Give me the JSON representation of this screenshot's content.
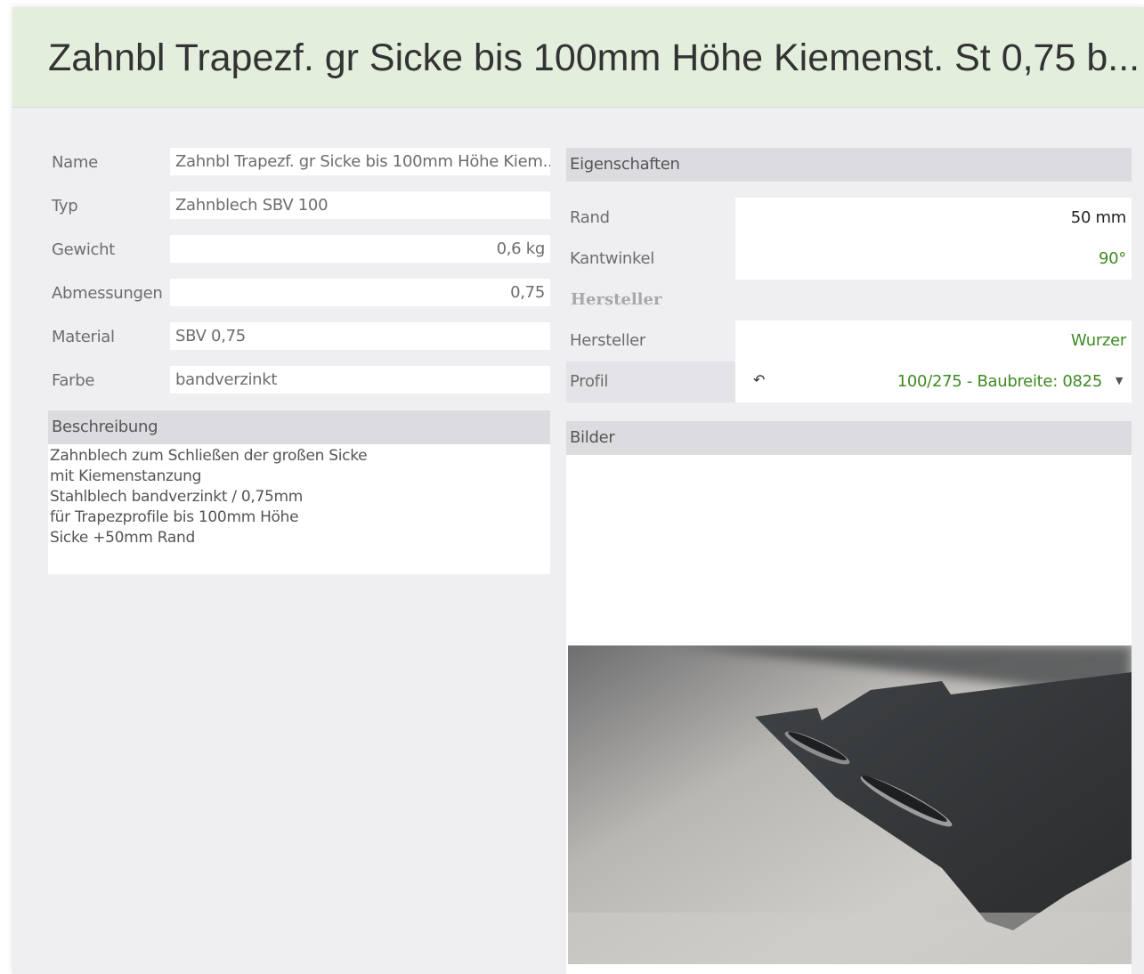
{
  "header": {
    "title": "Zahnbl Trapezf. gr Sicke bis 100mm Höhe Kiemenst. St 0,75 b..."
  },
  "fields": {
    "name": {
      "label": "Name",
      "value": "Zahnbl Trapezf. gr Sicke bis 100mm Höhe Kiem..."
    },
    "typ": {
      "label": "Typ",
      "value": "Zahnblech SBV 100"
    },
    "gewicht": {
      "label": "Gewicht",
      "value": "0,6 kg"
    },
    "abmessungen": {
      "label": "Abmessungen",
      "value": "0,75"
    },
    "material": {
      "label": "Material",
      "value": "SBV 0,75"
    },
    "farbe": {
      "label": "Farbe",
      "value": "bandverzinkt"
    }
  },
  "beschreibung": {
    "title": "Beschreibung",
    "lines": [
      "Zahnblech zum Schließen der großen Sicke",
      "mit Kiemenstanzung",
      "Stahlblech bandverzinkt / 0,75mm",
      "für Trapezprofile bis 100mm Höhe",
      "Sicke +50mm Rand"
    ]
  },
  "eigenschaften": {
    "title": "Eigenschaften",
    "rand": {
      "label": "Rand",
      "value": "50 mm"
    },
    "kantwinkel": {
      "label": "Kantwinkel",
      "value": "90°"
    },
    "hersteller_heading": "Hersteller",
    "hersteller": {
      "label": "Hersteller",
      "value": "Wurzer"
    },
    "profil": {
      "label": "Profil",
      "value": "100/275 - Baubreite: 0825"
    }
  },
  "bilder": {
    "title": "Bilder"
  },
  "colors": {
    "header_bg": "#e3efdc",
    "accent_green": "#3e8a24",
    "section_bg": "#dcdce0"
  },
  "icons": {
    "undo": "undo-icon",
    "dropdown": "dropdown-arrow-icon"
  }
}
